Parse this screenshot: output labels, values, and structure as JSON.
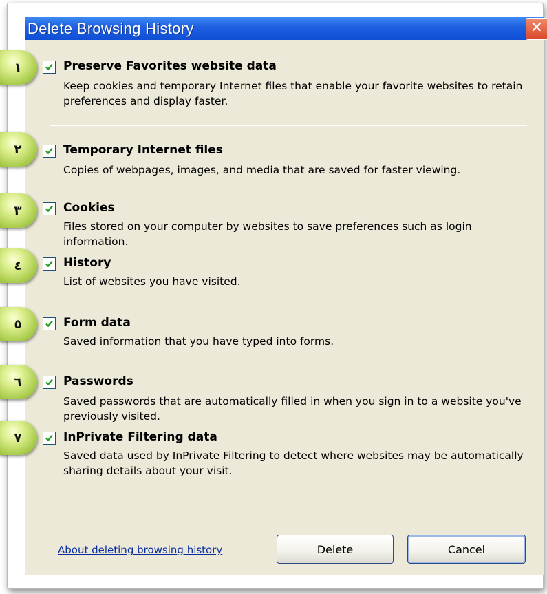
{
  "dialog": {
    "title": "Delete Browsing History",
    "close_glyph": "✕",
    "options": [
      {
        "badge": "١",
        "title": "Preserve Favorites website data",
        "description": "Keep cookies and temporary Internet files that enable your favorite websites to retain preferences and display faster.",
        "checked": true
      },
      {
        "badge": "٢",
        "title": "Temporary Internet files",
        "description": "Copies of webpages, images, and media that are saved for faster viewing.",
        "checked": true
      },
      {
        "badge": "٣",
        "title": "Cookies",
        "description": "Files stored on your computer by websites to save preferences such as login information.",
        "checked": true
      },
      {
        "badge": "٤",
        "title": "History",
        "description": "List of websites you have visited.",
        "checked": true
      },
      {
        "badge": "٥",
        "title": "Form data",
        "description": "Saved information that you have typed into forms.",
        "checked": true
      },
      {
        "badge": "٦",
        "title": "Passwords",
        "description": "Saved passwords that are automatically filled in when you sign in to a website you've previously visited.",
        "checked": true
      },
      {
        "badge": "٧",
        "title": "InPrivate Filtering data",
        "description": "Saved data used by InPrivate Filtering to detect where websites may be automatically sharing details about your visit.",
        "checked": true
      }
    ],
    "about_link": "About deleting browsing history",
    "delete_label": "Delete",
    "cancel_label": "Cancel"
  },
  "colors": {
    "titlebar": "#1f5fe0",
    "dialog_bg": "#ece9d8",
    "check": "#21a121",
    "badge": "#c3df72",
    "link": "#0a2ea0"
  },
  "icons": {
    "checkbox": "checkmark-icon",
    "close": "close-icon"
  }
}
